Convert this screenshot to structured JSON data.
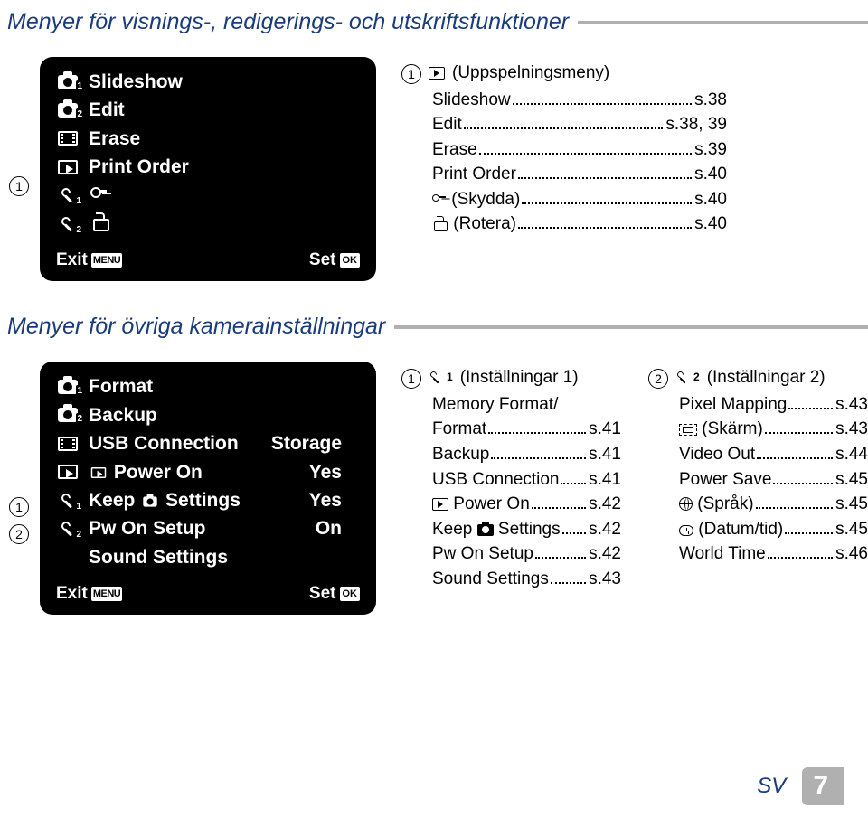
{
  "section1": {
    "title": "Menyer för visnings-, redigerings- och utskriftsfunktioner",
    "menu": {
      "items": [
        {
          "label": "Slideshow"
        },
        {
          "label": "Edit"
        },
        {
          "label": "Erase"
        },
        {
          "label": "Print Order"
        },
        {
          "label": ""
        },
        {
          "label": ""
        }
      ],
      "exit": "Exit",
      "menu_badge": "MENU",
      "set": "Set",
      "ok_badge": "OK"
    },
    "desc": {
      "head_label": "(Uppspelningsmeny)",
      "rows": [
        {
          "name": "Slideshow",
          "page": "s.38"
        },
        {
          "name": "Edit",
          "page": "s.38, 39"
        },
        {
          "name": "Erase",
          "page": "s.39"
        },
        {
          "name": "Print Order",
          "page": "s.40"
        },
        {
          "name_icon": "key",
          "name": "(Skydda)",
          "page": "s.40"
        },
        {
          "name_icon": "rotate",
          "name": "(Rotera)",
          "page": "s.40"
        }
      ]
    }
  },
  "section2": {
    "title": "Menyer för övriga kamerainställningar",
    "menu": {
      "items": [
        {
          "label": "Format",
          "value": ""
        },
        {
          "label": "Backup",
          "value": ""
        },
        {
          "label": "USB Connection",
          "value": "Storage"
        },
        {
          "icon": "play",
          "label": "Power On",
          "value": "Yes"
        },
        {
          "label_prefix": "Keep",
          "label_icon": "cam",
          "label_suffix": "Settings",
          "value": "Yes"
        },
        {
          "label": "Pw On Setup",
          "value": "On"
        },
        {
          "label": "Sound Settings",
          "value": ""
        }
      ],
      "exit": "Exit",
      "menu_badge": "MENU",
      "set": "Set",
      "ok_badge": "OK"
    },
    "desc1": {
      "head_label": "(Inställningar 1)",
      "rows": [
        {
          "name": "Memory Format/"
        },
        {
          "name": "Format",
          "page": "s.41"
        },
        {
          "name": "Backup",
          "page": "s.41"
        },
        {
          "name": "USB Connection",
          "page": "s.41"
        },
        {
          "name_icon": "play",
          "name": "Power On",
          "page": "s.42"
        },
        {
          "name": "Keep",
          "name_icon_after": "cam",
          "name2": " Settings",
          "page": "s.42"
        },
        {
          "name": "Pw On Setup",
          "page": "s.42"
        },
        {
          "name": "Sound Settings",
          "page": "s.43"
        }
      ]
    },
    "desc2": {
      "head_label": "(Inställningar 2)",
      "rows": [
        {
          "name": "Pixel Mapping",
          "page": "s.43"
        },
        {
          "name_icon": "screen",
          "name": "(Skärm)",
          "page": "s.43"
        },
        {
          "name": "Video Out",
          "page": "s.44"
        },
        {
          "name": "Power Save",
          "page": "s.45"
        },
        {
          "name_icon": "globe",
          "name": "(Språk)",
          "page": "s.45"
        },
        {
          "name_icon": "clock",
          "name": "(Datum/tid)",
          "page": "s.45"
        },
        {
          "name": "World Time",
          "page": "s.46"
        }
      ]
    }
  },
  "footer": {
    "lang": "SV",
    "page": "7"
  }
}
